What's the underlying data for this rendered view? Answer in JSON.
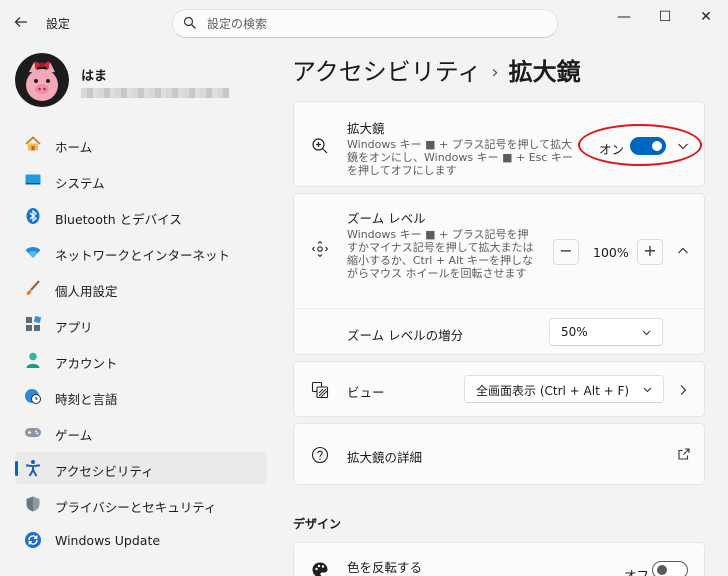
{
  "window": {
    "app_title": "設定",
    "minimize": "—",
    "maximize": "☐",
    "close": "✕"
  },
  "search": {
    "placeholder": "設定の検索"
  },
  "user": {
    "name": "はま"
  },
  "sidebar": {
    "items": [
      {
        "label": "ホーム",
        "icon": "home-icon",
        "active": false
      },
      {
        "label": "システム",
        "icon": "system-icon",
        "active": false
      },
      {
        "label": "Bluetooth とデバイス",
        "icon": "bluetooth-icon",
        "active": false
      },
      {
        "label": "ネットワークとインターネット",
        "icon": "wifi-icon",
        "active": false
      },
      {
        "label": "個人用設定",
        "icon": "brush-icon",
        "active": false
      },
      {
        "label": "アプリ",
        "icon": "apps-icon",
        "active": false
      },
      {
        "label": "アカウント",
        "icon": "account-icon",
        "active": false
      },
      {
        "label": "時刻と言語",
        "icon": "globe-clock-icon",
        "active": false
      },
      {
        "label": "ゲーム",
        "icon": "gamepad-icon",
        "active": false
      },
      {
        "label": "アクセシビリティ",
        "icon": "accessibility-icon",
        "active": true
      },
      {
        "label": "プライバシーとセキュリティ",
        "icon": "shield-icon",
        "active": false
      },
      {
        "label": "Windows Update",
        "icon": "update-icon",
        "active": false
      }
    ]
  },
  "header": {
    "parent": "アクセシビリティ",
    "separator": "›",
    "current": "拡大鏡"
  },
  "magnifier": {
    "title": "拡大鏡",
    "desc": "Windows キー ■ + プラス記号を押して拡大鏡をオンにし、Windows キー ■ + Esc キーを押してオフにします",
    "state_label": "オン",
    "enabled": true
  },
  "zoom": {
    "title": "ズーム レベル",
    "desc": "Windows キー ■ + プラス記号を押すかマイナス記号を押して拡大または縮小するか、Ctrl + Alt キーを押しながらマウス ホイールを回転させます",
    "value": "100%",
    "minus": "−",
    "plus": "+",
    "increment_label": "ズーム レベルの増分",
    "increment_value": "50%"
  },
  "view": {
    "title": "ビュー",
    "value": "全画面表示 (Ctrl + Alt + F)"
  },
  "details": {
    "title": "拡大鏡の詳細"
  },
  "design": {
    "section_title": "デザイン",
    "invert_title": "色を反転する",
    "invert_state": "オフ",
    "enabled": false
  },
  "colors": {
    "accent": "#0067c0",
    "highlight_ring": "#e0151b"
  }
}
